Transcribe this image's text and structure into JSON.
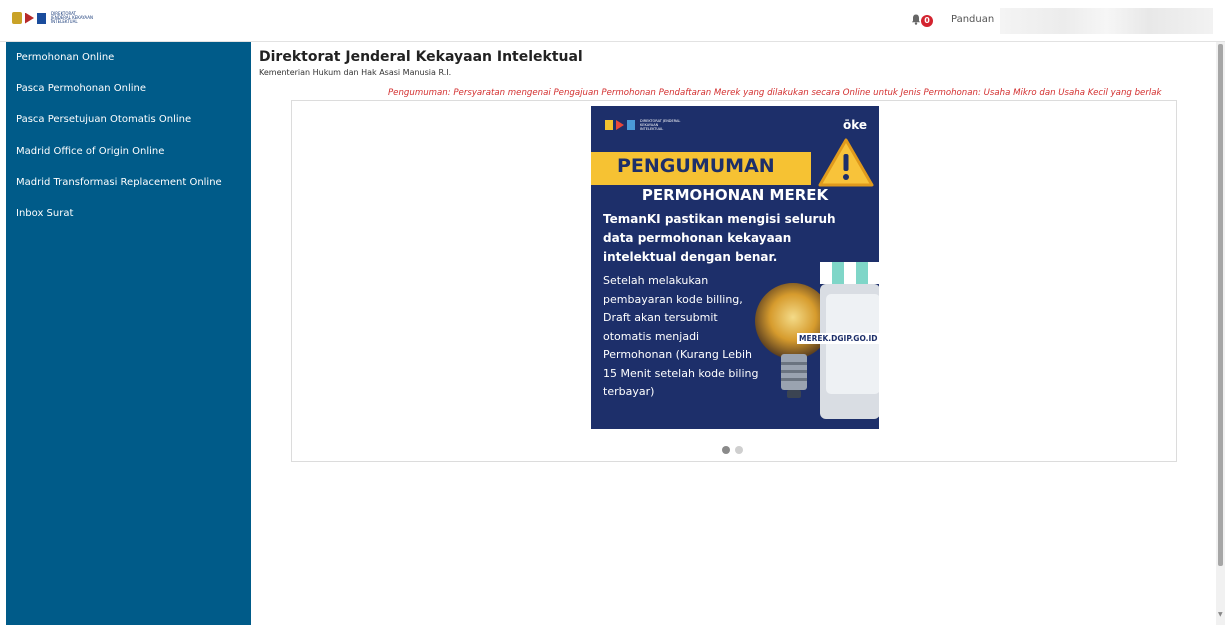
{
  "header": {
    "logo_text": "DIREKTORAT JENDERAL KEKAYAAN INTELEKTUAL",
    "notification_count": "0",
    "guide_label": "Panduan"
  },
  "sidebar": {
    "items": [
      {
        "label": "Permohonan Online"
      },
      {
        "label": "Pasca Permohonan Online"
      },
      {
        "label": "Pasca Persetujuan Otomatis Online"
      },
      {
        "label": "Madrid Office of Origin Online"
      },
      {
        "label": "Madrid Transformasi Replacement Online"
      },
      {
        "label": "Inbox Surat"
      }
    ]
  },
  "main": {
    "title": "Direktorat Jenderal Kekayaan Intelektual",
    "subtitle": "Kementerian Hukum dan Hak Asasi Manusia R.I.",
    "announcement": "Pengumuman: Persyaratan mengenai Pengajuan Permohonan Pendaftaran Merek yang dilakukan secara Online untuk Jenis Permohonan: Usaha Mikro dan Usaha Kecil yang berlak"
  },
  "poster": {
    "logo_text": "DIREKTORAT JENDERAL KEKAYAAN INTELEKTUAL",
    "oke_text": "ōke",
    "band_text": "PENGUMUMAN",
    "heading": "PERMOHONAN MEREK",
    "bold_text": "TemanKI pastikan mengisi seluruh data permohonan kekayaan intelektual dengan benar.",
    "body_text": "Setelah melakukan pembayaran kode billing, Draft akan tersubmit otomatis menjadi Permohonan (Kurang Lebih 15 Menit setelah kode biling terbayar)",
    "shop_label": "MEREK.DGIP.GO.ID"
  },
  "carousel": {
    "slide_count": 2,
    "active_slide": 1
  },
  "colors": {
    "sidebar_bg": "#005b89",
    "announcement_text": "#d32f2f",
    "poster_bg": "#1d2f6a",
    "poster_band": "#f6c233",
    "badge": "#d3232f"
  }
}
